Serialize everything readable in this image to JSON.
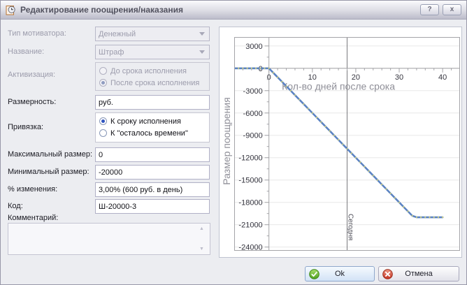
{
  "window": {
    "title": "Редактирование поощрения/наказания",
    "help": "?",
    "close": "x"
  },
  "form": {
    "motivator_type": {
      "label": "Тип мотиватора:",
      "value": "Денежный",
      "disabled": true
    },
    "name": {
      "label": "Название:",
      "value": "Штраф",
      "disabled": true
    },
    "activation": {
      "label": "Активизация:",
      "options": [
        "До срока исполнения",
        "После срока исполнения"
      ],
      "selected": "После срока исполнения",
      "disabled": true
    },
    "dimension": {
      "label": "Размерность:",
      "value": "руб."
    },
    "binding": {
      "label": "Привязка:",
      "options": [
        "К сроку исполнения",
        "К \"осталось времени\""
      ],
      "selected": "К сроку исполнения"
    },
    "max_size": {
      "label": "Максимальный размер:",
      "value": "0"
    },
    "min_size": {
      "label": "Минимальный размер:",
      "value": "-20000"
    },
    "percent_change": {
      "label": "% изменения:",
      "value": "3,00% (600 руб. в день)"
    },
    "code": {
      "label": "Код:",
      "value": "Ш-20000-3"
    },
    "comment": {
      "label": "Комментарий:",
      "value": ""
    }
  },
  "buttons": {
    "ok": "Ok",
    "cancel": "Отмена"
  },
  "chart_data": {
    "type": "line",
    "title": "",
    "xlabel": "Кол-во дней после срока",
    "ylabel": "Размер поощрения",
    "xlim": [
      -8,
      44
    ],
    "ylim": [
      -24500,
      4200
    ],
    "xticks": [
      0,
      10,
      20,
      30,
      40
    ],
    "x_minor_step": 2,
    "yticks": [
      3000,
      0,
      -3000,
      -6000,
      -9000,
      -12000,
      -15000,
      -18000,
      -21000,
      -24000
    ],
    "y_minor_step": 1500,
    "today": {
      "x": 18,
      "label": "Сегодня"
    },
    "grid": true,
    "colors": {
      "line": "#5b83c3",
      "marker": "#cfcf7a",
      "axis": "#a4a4a8",
      "grid": "#e8e8e8",
      "today_line": "#7a7a7e",
      "tick_text": "#35353f",
      "axis_title": "#8f8f98"
    },
    "series": [
      {
        "name": "Размер поощрения",
        "x": [
          -8,
          -7,
          -6,
          -5,
          -4,
          -3,
          -2,
          -1,
          0,
          1,
          2,
          3,
          4,
          5,
          6,
          7,
          8,
          9,
          10,
          11,
          12,
          13,
          14,
          15,
          16,
          17,
          18,
          19,
          20,
          21,
          22,
          23,
          24,
          25,
          26,
          27,
          28,
          29,
          30,
          31,
          32,
          33,
          34,
          35,
          36,
          37,
          38,
          39,
          40
        ],
        "y": [
          0,
          0,
          0,
          0,
          0,
          0,
          0,
          0,
          0,
          -600,
          -1200,
          -1800,
          -2400,
          -3000,
          -3600,
          -4200,
          -4800,
          -5400,
          -6000,
          -6600,
          -7200,
          -7800,
          -8400,
          -9000,
          -9600,
          -10200,
          -10800,
          -11400,
          -12000,
          -12600,
          -13200,
          -13800,
          -14400,
          -15000,
          -15600,
          -16200,
          -16800,
          -17400,
          -18000,
          -18600,
          -19200,
          -19800,
          -20000,
          -20000,
          -20000,
          -20000,
          -20000,
          -20000,
          -20000
        ]
      }
    ]
  }
}
